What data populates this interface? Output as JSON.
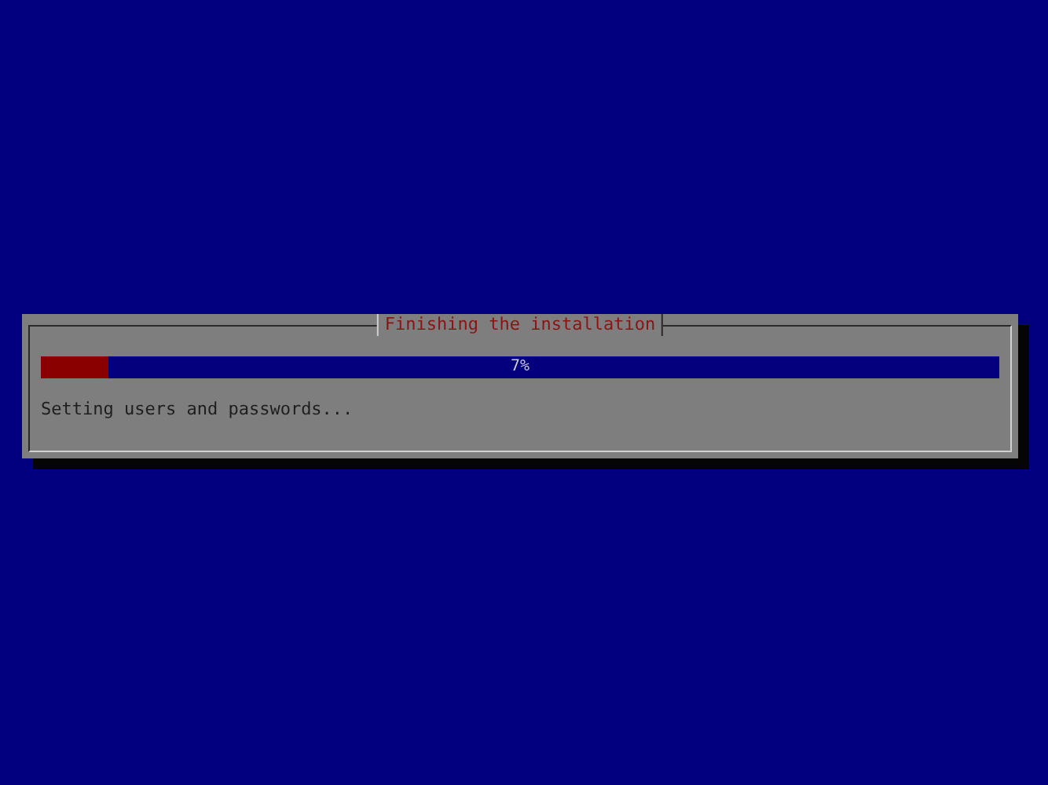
{
  "dialog": {
    "title": "Finishing the installation",
    "progress": {
      "level": 0.07,
      "reading": "7%"
    },
    "status": "Setting users and passwords..."
  }
}
